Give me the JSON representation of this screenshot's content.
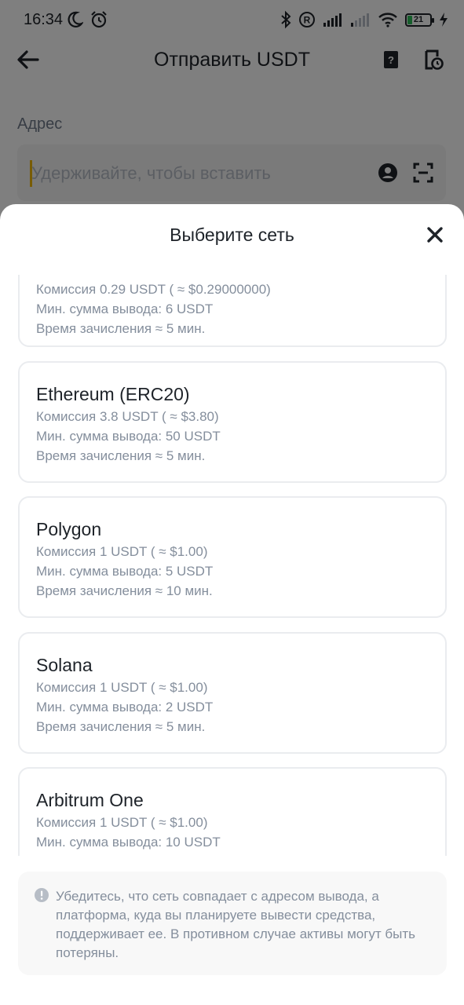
{
  "status_bar": {
    "time": "16:34",
    "battery": "21",
    "left_icons": [
      "moon-icon",
      "alarm-icon"
    ],
    "right_icons": [
      "bluetooth-icon",
      "registered-icon",
      "signal-icon",
      "signal-weak-icon",
      "wifi-icon",
      "battery-icon",
      "charging-icon"
    ]
  },
  "header": {
    "title": "Отправить USDT",
    "icons": [
      "back-arrow-icon",
      "address-book-icon",
      "history-icon"
    ]
  },
  "address": {
    "label": "Адрес",
    "placeholder": "Удерживайте, чтобы вставить",
    "icons": [
      "contact-icon",
      "scan-icon"
    ]
  },
  "sheet": {
    "title": "Выберите сеть",
    "close_icon": "close-icon",
    "networks": [
      {
        "name": "",
        "fee": "Комиссия 0.29 USDT ( ≈ $0.29000000)",
        "min": "Мин. сумма вывода: 6 USDT",
        "time": "Время зачисления ≈ 5 мин."
      },
      {
        "name": "Ethereum (ERC20)",
        "fee": "Комиссия 3.8 USDT ( ≈ $3.80)",
        "min": "Мин. сумма вывода: 50 USDT",
        "time": "Время зачисления ≈ 5 мин."
      },
      {
        "name": "Polygon",
        "fee": "Комиссия 1 USDT ( ≈ $1.00)",
        "min": "Мин. сумма вывода: 5 USDT",
        "time": "Время зачисления ≈ 10 мин."
      },
      {
        "name": "Solana",
        "fee": "Комиссия 1 USDT ( ≈ $1.00)",
        "min": "Мин. сумма вывода: 2 USDT",
        "time": "Время зачисления ≈ 5 мин."
      },
      {
        "name": "Arbitrum One",
        "fee": "Комиссия 1 USDT ( ≈ $1.00)",
        "min": "Мин. сумма вывода: 10 USDT",
        "time": ""
      }
    ],
    "notice": "Убедитесь, что сеть совпадает с адресом вывода, а платформа, куда вы планируете вывести средства, поддерживает ее. В противном случае активы могут быть потеряны.",
    "notice_icon": "info-icon"
  },
  "colors": {
    "accent": "#f0b90b",
    "text_primary": "#1e2329",
    "text_secondary": "#848e9c",
    "battery_green": "#2ebd58"
  }
}
